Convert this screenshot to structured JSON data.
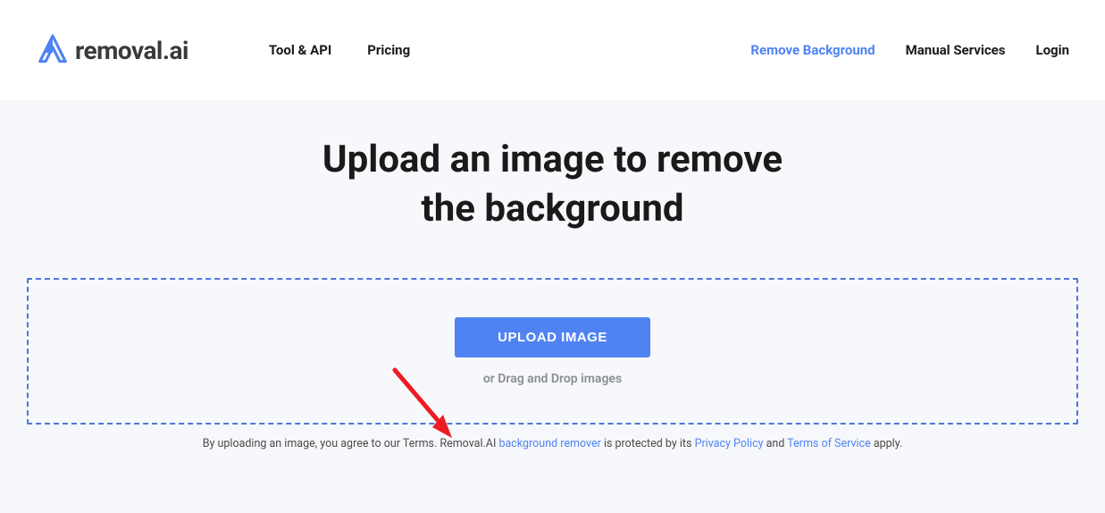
{
  "header": {
    "logo_text": "removal.ai",
    "nav_left": {
      "tool_api": "Tool & API",
      "pricing": "Pricing"
    },
    "nav_right": {
      "remove_background": "Remove Background",
      "manual_services": "Manual Services",
      "login": "Login"
    }
  },
  "hero": {
    "title_line1": "Upload an image to remove",
    "title_line2": "the background",
    "upload_button": "UPLOAD IMAGE",
    "drag_text": "or Drag and Drop images"
  },
  "terms": {
    "prefix": "By uploading an image, you agree to our Terms. Removal.AI ",
    "link1": "background remover",
    "mid1": " is protected by its ",
    "link2": "Privacy Policy",
    "mid2": " and ",
    "link3": "Terms of Service",
    "suffix": " apply."
  },
  "colors": {
    "accent": "#5083f2",
    "border_dashed": "#4d77d9",
    "bg_hero": "#f7f8fb",
    "arrow": "#ed1c24"
  }
}
